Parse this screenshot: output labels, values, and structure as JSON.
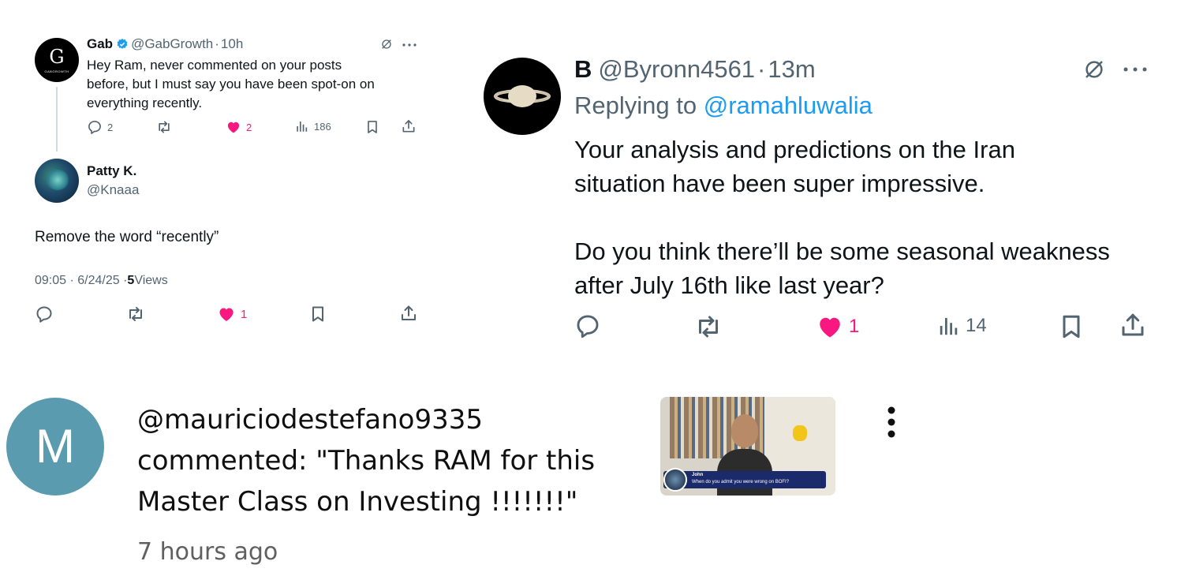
{
  "tweet_gab": {
    "name": "Gab",
    "handle": "@GabGrowth",
    "dot": "·",
    "time": "10h",
    "avatar_letter": "G",
    "avatar_sub": "GABGROWTH",
    "text_lines": [
      "Hey Ram, never commented on your posts",
      "before, but I must say you have been spot-on on",
      "everything recently."
    ],
    "replies": "2",
    "likes": "2",
    "views": "186"
  },
  "tweet_patty": {
    "name": "Patty K.",
    "handle": "@Knaaa",
    "text": "Remove the word “recently”",
    "time": "09:05 · 6/24/25 · ",
    "views_count": "5",
    "views_label": " Views",
    "likes": "1"
  },
  "tweet_byron": {
    "name": "B",
    "handle": "@Byronn4561",
    "dot": "·",
    "time": "13m",
    "replying_prefix": "Replying to ",
    "replying_handle": "@ramahluwalia",
    "text_lines": [
      "Your analysis and predictions on the Iran",
      "situation have been super impressive.",
      "",
      "Do you think there’ll be some seasonal weakness",
      "after July 16th like last year?"
    ],
    "likes": "1",
    "views": "14"
  },
  "youtube_comment": {
    "avatar_letter": "M",
    "author": "@mauriciodestefano9335",
    "text_line1": "commented: \"Thanks RAM for this",
    "text_line2": "Master Class on Investing !!!!!!!\"",
    "time": "7 hours ago",
    "thumb_caption_name": "John",
    "thumb_caption_text": "When do you admit you were wrong on BOFI?"
  },
  "colors": {
    "like_pink": "#f91880",
    "link_blue": "#1d9bf0",
    "muted_gray": "#536471",
    "avatar_teal": "#5a9bb0"
  },
  "icons": [
    "grok-icon",
    "more-icon",
    "reply-icon",
    "retweet-icon",
    "heart-icon",
    "views-icon",
    "bookmark-icon",
    "share-icon",
    "verified-icon",
    "kebab-menu-icon"
  ]
}
